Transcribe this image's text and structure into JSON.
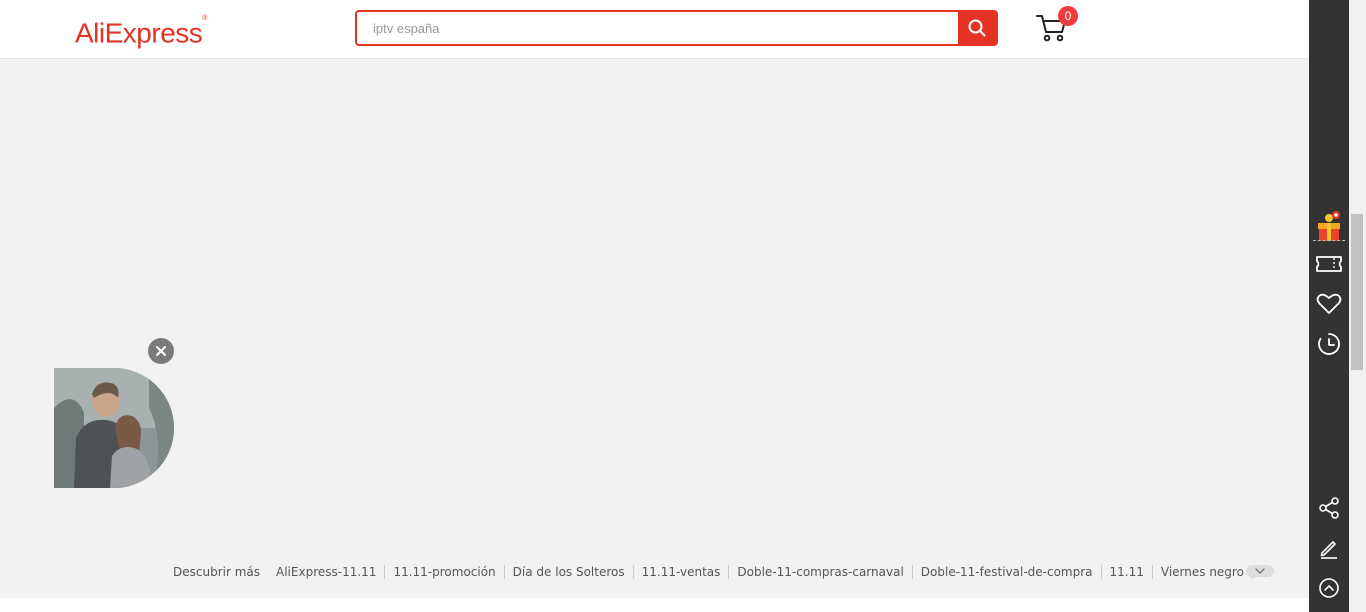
{
  "header": {
    "logo_text": "AliExpress",
    "logo_mark": "®",
    "search": {
      "placeholder": "iptv españa",
      "value": ""
    },
    "search_button_icon": "search-icon",
    "cart": {
      "icon": "cart-icon",
      "count": "0"
    }
  },
  "sidebar": {
    "items": [
      {
        "icon": "gift-icon"
      },
      {
        "icon": "coupon-icon"
      },
      {
        "icon": "heart-icon"
      },
      {
        "icon": "history-clock-icon"
      },
      {
        "icon": "share-icon"
      },
      {
        "icon": "edit-pencil-icon"
      },
      {
        "icon": "back-to-top-icon"
      }
    ]
  },
  "float_widget": {
    "close_icon": "close-icon",
    "image": "couple-photo"
  },
  "footer": {
    "lead": "Descubrir más",
    "links": [
      "AliExpress-11.11",
      "11.11-promoción",
      "Día de los Solteros",
      "11.11-ventas",
      "Doble-11-compras-carnaval",
      "Doble-11-festival-de-compra",
      "11.11",
      "Viernes negro"
    ],
    "toggle_icon": "chevron-down-icon"
  },
  "colors": {
    "brand": "#e43225",
    "sidebar_bg": "#333333",
    "page_bg": "#f2f2f2",
    "badge": "#f03c3c"
  }
}
